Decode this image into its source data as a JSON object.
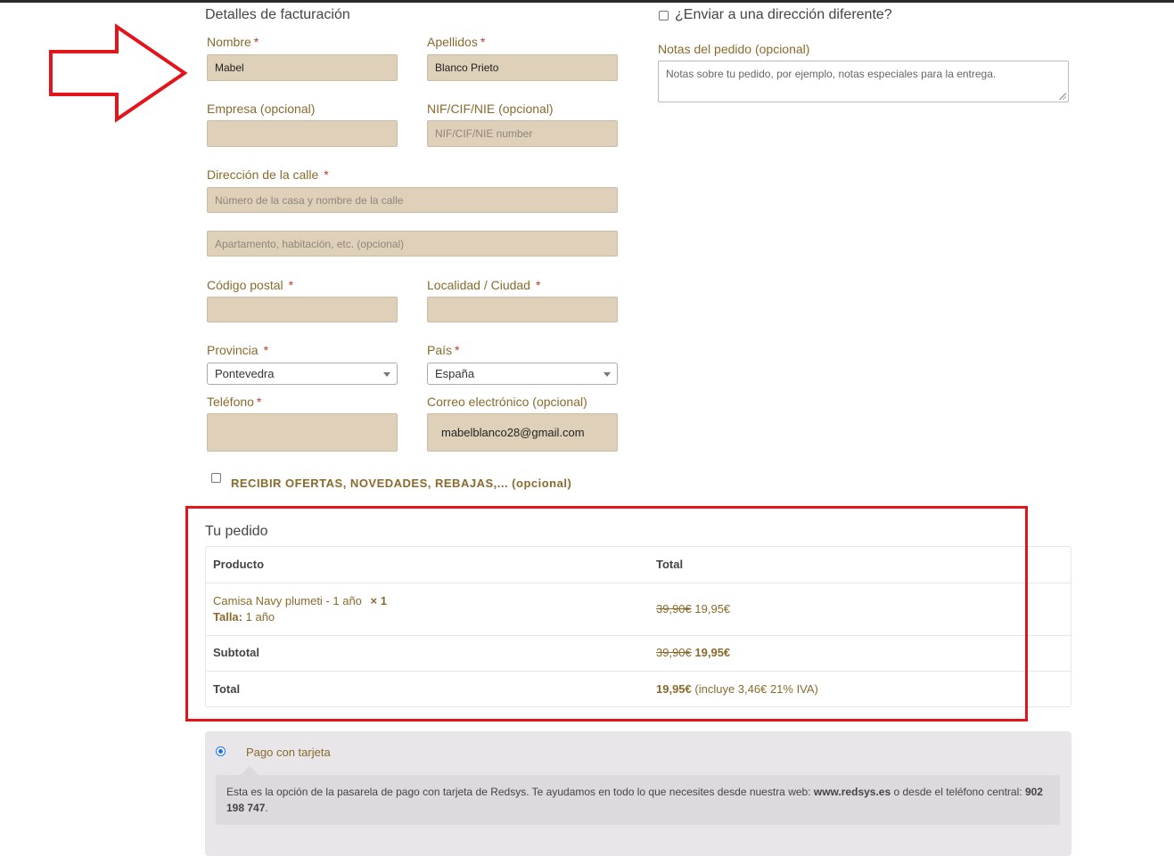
{
  "billing": {
    "title": "Detalles de facturación",
    "first_name": {
      "label": "Nombre",
      "value": "Mabel"
    },
    "last_name": {
      "label": "Apellidos",
      "value": "Blanco Prieto"
    },
    "company": {
      "label": "Empresa (opcional)",
      "value": ""
    },
    "nif": {
      "label": "NIF/CIF/NIE (opcional)",
      "placeholder": "NIF/CIF/NIE number"
    },
    "street": {
      "label": "Dirección de la calle",
      "placeholder1": "Número de la casa y nombre de la calle",
      "placeholder2": "Apartamento, habitación, etc. (opcional)"
    },
    "postcode": {
      "label": "Código postal",
      "value": ""
    },
    "city": {
      "label": "Localidad / Ciudad",
      "value": ""
    },
    "province": {
      "label": "Provincia",
      "value": "Pontevedra"
    },
    "country": {
      "label": "País",
      "value": "España"
    },
    "phone": {
      "label": "Teléfono",
      "value": ""
    },
    "email": {
      "label": "Correo electrónico (opcional)",
      "value": "mabelblanco28@gmail.com"
    },
    "newsletter_label": "RECIBIR OFERTAS, NOVEDADES, REBAJAS,... (opcional)",
    "required_mark": "*"
  },
  "shipping": {
    "different_address_label": "¿Enviar a una dirección diferente?",
    "notes_label": "Notas del pedido (opcional)",
    "notes_placeholder": "Notas sobre tu pedido, por ejemplo, notas especiales para la entrega."
  },
  "order": {
    "title": "Tu pedido",
    "col_product": "Producto",
    "col_total": "Total",
    "item_name": "Camisa Navy plumeti - 1 año",
    "item_qty": "× 1",
    "item_meta_key": "Talla:",
    "item_meta_value": "1 año",
    "item_old_price": "39,90€",
    "item_price": "19,95€",
    "subtotal_label": "Subtotal",
    "subtotal_old": "39,90€",
    "subtotal_new": "19,95€",
    "total_label": "Total",
    "total_value": "19,95€",
    "total_tax_note": "(incluye 3,46€ 21% IVA)"
  },
  "payment": {
    "method_label": "Pago con tarjeta",
    "desc_text": "Esta es la opción de la pasarela de pago con tarjeta de Redsys. Te ayudamos en todo lo que necesites desde nuestra web: ",
    "desc_site": "www.redsys.es",
    "desc_mid": " o desde el teléfono central: ",
    "desc_phone": "902 198 747",
    "desc_end": "."
  },
  "colors": {
    "accent": "#8a6a2c",
    "field_bg": "#dfd0ba",
    "annotation_red": "#e3141c"
  },
  "annotations": {
    "arrow": "red-outline-right-arrow",
    "highlight": "red-rectangle-order-summary"
  }
}
